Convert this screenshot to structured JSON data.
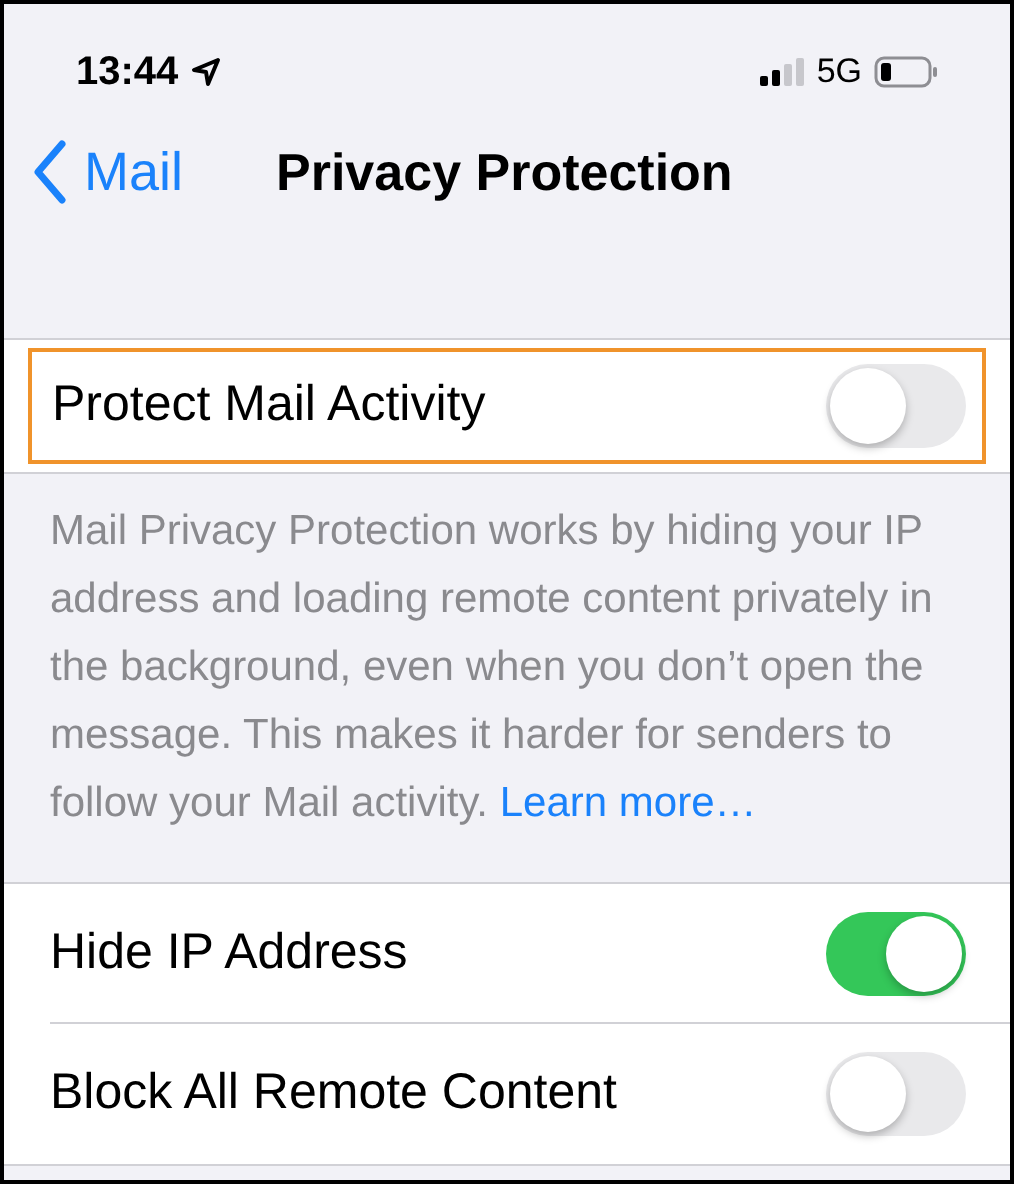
{
  "status_bar": {
    "time": "13:44",
    "network": "5G"
  },
  "nav": {
    "back_label": "Mail",
    "title": "Privacy Protection"
  },
  "main_setting": {
    "label": "Protect Mail Activity",
    "on": false,
    "highlighted": true
  },
  "description": {
    "text": "Mail Privacy Protection works by hiding your IP address and loading remote content privately in the background, even when you don’t open the message. This makes it harder for senders to follow your Mail activity.",
    "link": "Learn more…"
  },
  "settings": [
    {
      "label": "Hide IP Address",
      "on": true
    },
    {
      "label": "Block All Remote Content",
      "on": false
    }
  ]
}
